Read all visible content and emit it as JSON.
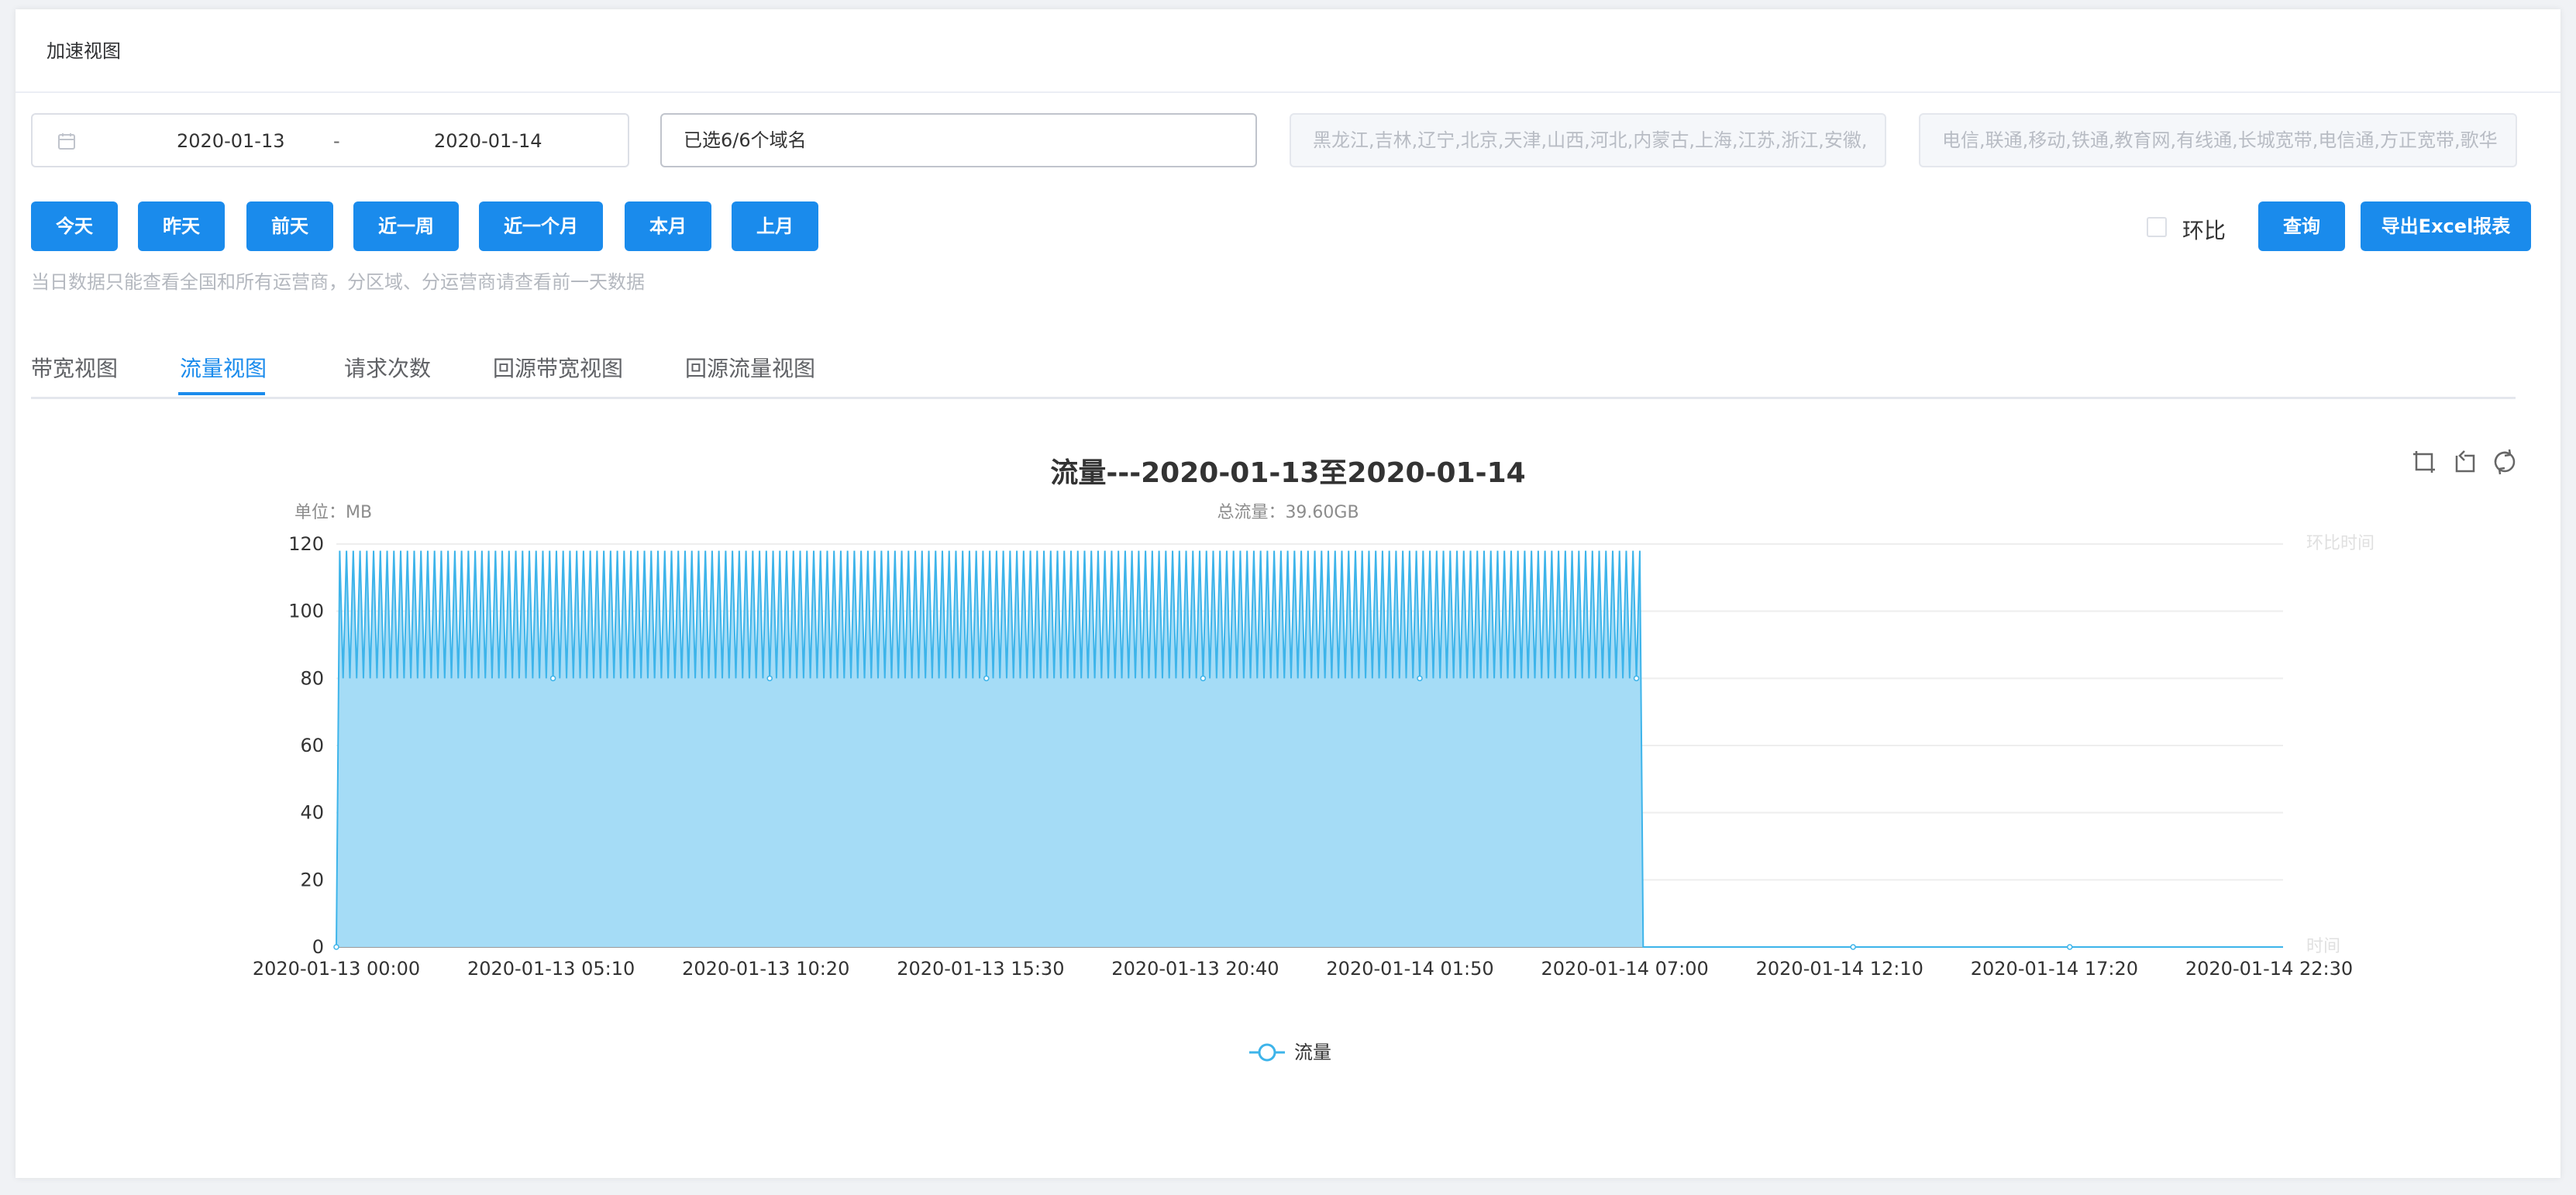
{
  "panel": {
    "title": "加速视图"
  },
  "filters": {
    "date_start": "2020-01-13",
    "date_separator": "-",
    "date_end": "2020-01-14",
    "domain_value": "已选6/6个域名",
    "region_value": "黑龙江,吉林,辽宁,北京,天津,山西,河北,内蒙古,上海,江苏,浙江,安徽,",
    "isp_value": "电信,联通,移动,铁通,教育网,有线通,长城宽带,电信通,方正宽带,歌华"
  },
  "quick_buttons": [
    "今天",
    "昨天",
    "前天",
    "近一周",
    "近一个月",
    "本月",
    "上月"
  ],
  "compare_label": "环比",
  "query_label": "查询",
  "export_label": "导出Excel报表",
  "hint": "当日数据只能查看全国和所有运营商，分区域、分运营商请查看前一天数据",
  "tabs": [
    "带宽视图",
    "流量视图",
    "请求次数",
    "回源带宽视图",
    "回源流量视图"
  ],
  "active_tab": "流量视图",
  "icons": [
    "calendar-icon",
    "zoom-area-icon",
    "zoom-reset-icon",
    "restore-icon"
  ],
  "colors": {
    "accent": "#1a8bec",
    "series_fill": "#a5dcf6",
    "series_line": "#3db4ea"
  },
  "chart_data": {
    "type": "area",
    "title": "流量---2020-01-13至2020-01-14",
    "unit_label": "单位：MB",
    "total_label": "总流量：39.60GB",
    "xlabel": "时间",
    "secondary_xlabel": "环比时间",
    "ylim": [
      0,
      120
    ],
    "yticks": [
      0,
      20,
      40,
      60,
      80,
      100,
      120
    ],
    "x_ticks": [
      "2020-01-13 00:00",
      "2020-01-13 05:10",
      "2020-01-13 10:20",
      "2020-01-13 15:30",
      "2020-01-13 20:40",
      "2020-01-14 01:50",
      "2020-01-14 07:00",
      "2020-01-14 12:10",
      "2020-01-14 17:20",
      "2020-01-14 22:30"
    ],
    "grid": true,
    "legend_position": "bottom-center",
    "series": [
      {
        "name": "流量",
        "pattern": "alternating ~118 MB peaks and ~80 MB troughs every 5 minutes from 2020-01-13 00:00 to ~2020-01-14 09:00, then 0",
        "start": "2020-01-13 00:00",
        "interval_minutes": 5,
        "active_points": 386,
        "peak_value": 118,
        "trough_value": 80,
        "total_points": 576
      }
    ]
  }
}
